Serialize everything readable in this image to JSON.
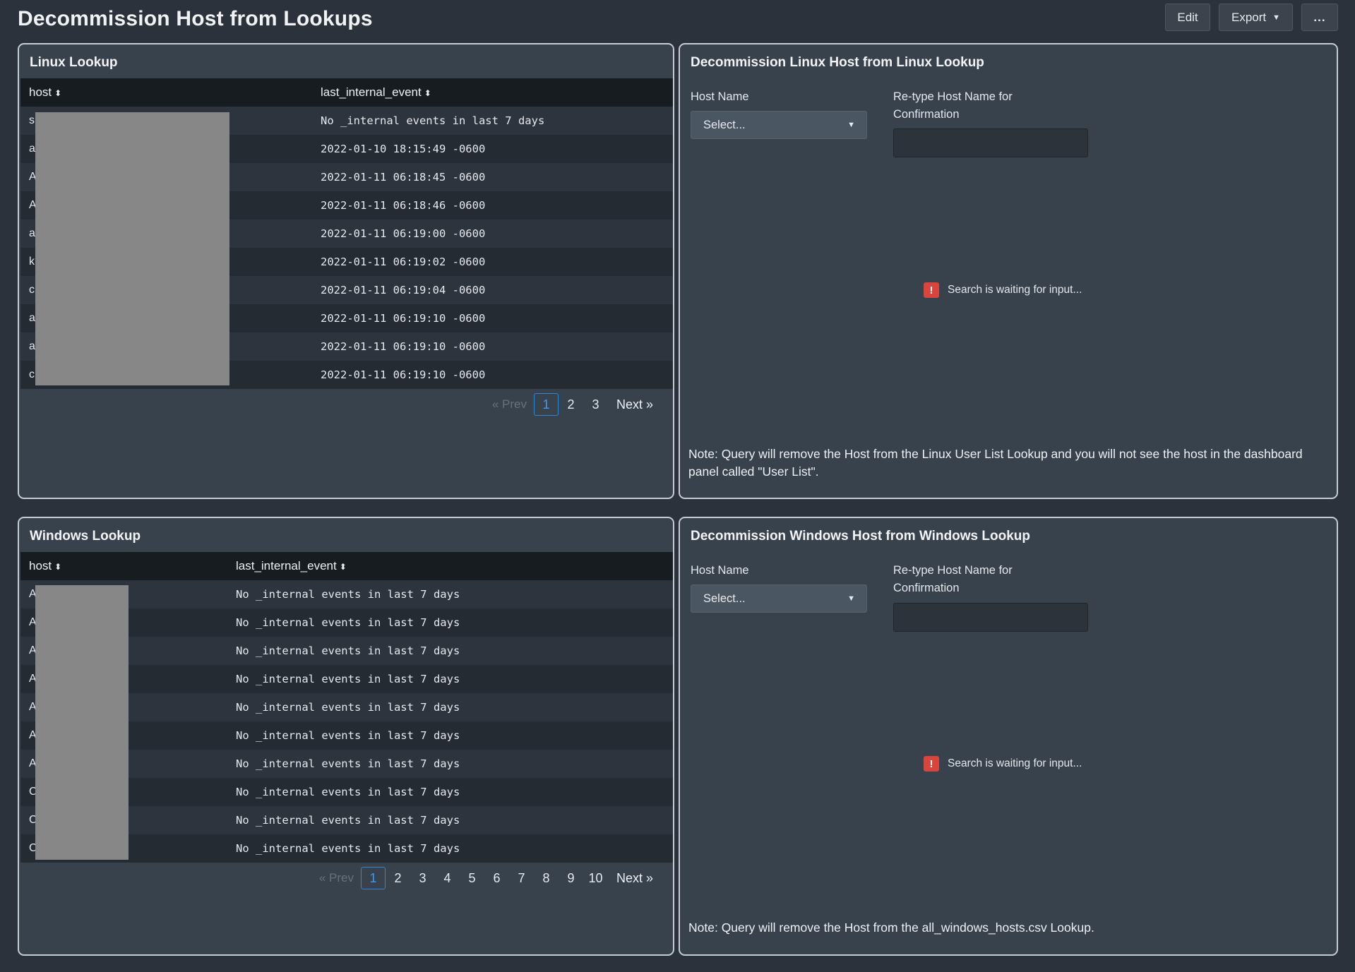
{
  "header": {
    "title": "Decommission Host from Lookups",
    "edit_label": "Edit",
    "export_label": "Export",
    "more_label": "..."
  },
  "linux_lookup": {
    "title": "Linux Lookup",
    "columns": [
      "host",
      "last_internal_event"
    ],
    "rows": [
      {
        "host": "s",
        "event": "No _internal events in last 7 days"
      },
      {
        "host": "a",
        "event": "2022-01-10 18:15:49 -0600"
      },
      {
        "host": "A",
        "event": "2022-01-11 06:18:45 -0600"
      },
      {
        "host": "A",
        "event": "2022-01-11 06:18:46 -0600"
      },
      {
        "host": "a",
        "event": "2022-01-11 06:19:00 -0600"
      },
      {
        "host": "k",
        "event": "2022-01-11 06:19:02 -0600"
      },
      {
        "host": "c",
        "event": "2022-01-11 06:19:04 -0600"
      },
      {
        "host": "a",
        "event": "2022-01-11 06:19:10 -0600"
      },
      {
        "host": "a",
        "event": "2022-01-11 06:19:10 -0600"
      },
      {
        "host": "c",
        "event": "2022-01-11 06:19:10 -0600"
      }
    ],
    "pagination": {
      "prev": "« Prev",
      "pages": [
        "1",
        "2",
        "3"
      ],
      "current": "1",
      "next": "Next »"
    }
  },
  "linux_decommission": {
    "title": "Decommission Linux Host from Linux Lookup",
    "host_name_label": "Host Name",
    "select_placeholder": "Select...",
    "retype_label_line1": "Re-type Host Name for",
    "retype_label_line2": "Confirmation",
    "retype_value": "",
    "waiting_text": "Search is waiting for input...",
    "note": "Note: Query will remove the Host from the Linux User List Lookup and you will not see the host in the dashboard panel called \"User List\"."
  },
  "windows_lookup": {
    "title": "Windows Lookup",
    "columns": [
      "host",
      "last_internal_event"
    ],
    "rows": [
      {
        "host": "A",
        "event": "No _internal events in last 7 days"
      },
      {
        "host": "A",
        "event": "No _internal events in last 7 days"
      },
      {
        "host": "A",
        "event": "No _internal events in last 7 days"
      },
      {
        "host": "A",
        "event": "No _internal events in last 7 days"
      },
      {
        "host": "A",
        "event": "No _internal events in last 7 days"
      },
      {
        "host": "A",
        "event": "No _internal events in last 7 days"
      },
      {
        "host": "A",
        "event": "No _internal events in last 7 days"
      },
      {
        "host": "C",
        "event": "No _internal events in last 7 days"
      },
      {
        "host": "C",
        "event": "No _internal events in last 7 days"
      },
      {
        "host": "C",
        "event": "No _internal events in last 7 days"
      }
    ],
    "pagination": {
      "prev": "« Prev",
      "pages": [
        "1",
        "2",
        "3",
        "4",
        "5",
        "6",
        "7",
        "8",
        "9",
        "10"
      ],
      "current": "1",
      "next": "Next »"
    }
  },
  "windows_decommission": {
    "title": "Decommission Windows Host from Windows Lookup",
    "host_name_label": "Host Name",
    "select_placeholder": "Select...",
    "retype_label_line1": "Re-type Host Name for",
    "retype_label_line2": "Confirmation",
    "retype_value": "",
    "waiting_text": "Search is waiting for input...",
    "note": "Note: Query will remove the Host from the all_windows_hosts.csv Lookup."
  },
  "icons": {
    "sort": "sort-icon",
    "dropdown": "caret-down-icon",
    "warning": "warning-icon"
  },
  "colors": {
    "background": "#2b323b",
    "panel": "#37424d",
    "panel_border": "#c5ccd3",
    "accent": "#2c87d8",
    "warning": "#d9453c",
    "redaction": "#878787"
  }
}
